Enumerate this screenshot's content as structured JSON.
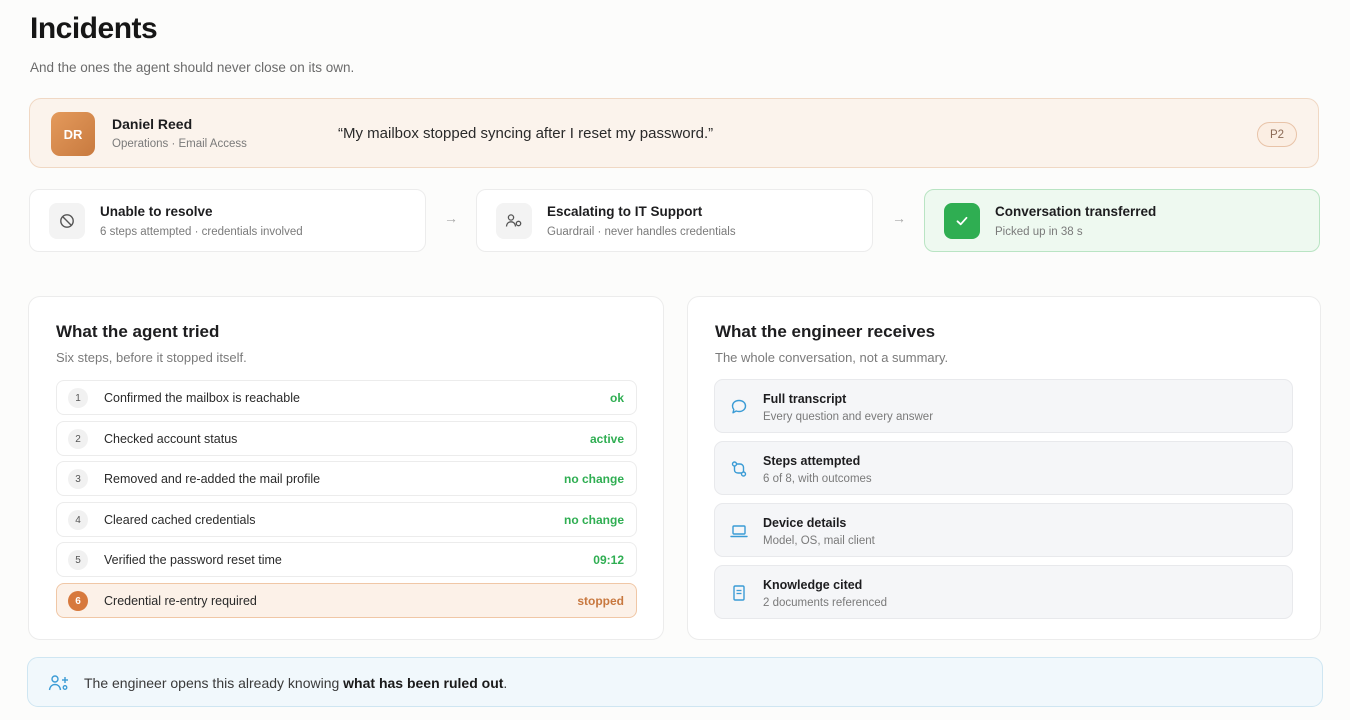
{
  "header": {
    "title": "Incidents",
    "subtitle": "And the ones the agent should never close on its own."
  },
  "requester": {
    "initials": "DR",
    "name": "Daniel Reed",
    "meta": "Operations · Email Access",
    "quote": "“My mailbox stopped syncing after I reset my password.”",
    "priority": "P2"
  },
  "flow": [
    {
      "title": "Unable to resolve",
      "subtitle": "6 steps attempted · credentials involved",
      "icon": "ban-icon"
    },
    {
      "title": "Escalating to IT Support",
      "subtitle": "Guardrail · never handles credentials",
      "icon": "users-icon"
    },
    {
      "title": "Conversation transferred",
      "subtitle": "Picked up in 38 s",
      "icon": "check-icon"
    }
  ],
  "agent_panel": {
    "title": "What the agent tried",
    "subtitle": "Six steps, before it stopped itself.",
    "steps": [
      {
        "num": "1",
        "label": "Confirmed the mailbox is reachable",
        "status": "ok"
      },
      {
        "num": "2",
        "label": "Checked account status",
        "status": "active"
      },
      {
        "num": "3",
        "label": "Removed and re-added the mail profile",
        "status": "no change"
      },
      {
        "num": "4",
        "label": "Cleared cached credentials",
        "status": "no change"
      },
      {
        "num": "5",
        "label": "Verified the password reset time",
        "status": "09:12"
      },
      {
        "num": "6",
        "label": "Credential re-entry required",
        "status": "stopped"
      }
    ]
  },
  "engineer_panel": {
    "title": "What the engineer receives",
    "subtitle": "The whole conversation, not a summary.",
    "items": [
      {
        "title": "Full transcript",
        "subtitle": "Every question and every answer",
        "icon": "chat-bubble-icon"
      },
      {
        "title": "Steps attempted",
        "subtitle": "6 of 8, with outcomes",
        "icon": "route-icon"
      },
      {
        "title": "Device details",
        "subtitle": "Model, OS, mail client",
        "icon": "laptop-icon"
      },
      {
        "title": "Knowledge cited",
        "subtitle": "2 documents referenced",
        "icon": "document-icon"
      }
    ]
  },
  "footer": {
    "text_prefix": "The engineer opens this already knowing ",
    "text_bold": "what has been ruled out",
    "text_suffix": "."
  },
  "colors": {
    "accent_orange": "#d7793d",
    "success_green": "#2fae52",
    "info_blue": "#3a9bd5"
  }
}
